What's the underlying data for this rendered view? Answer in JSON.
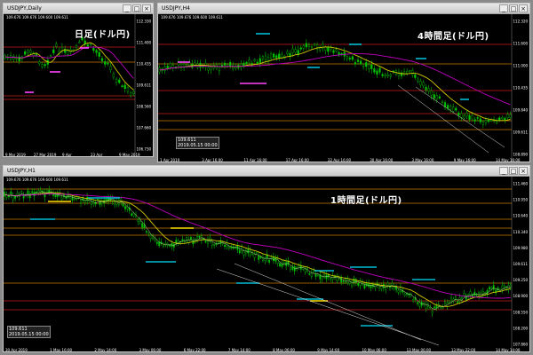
{
  "windows": [
    {
      "id": "daily",
      "title": "USDJPY,Daily",
      "ohlc": "109.676 109.676 109.600 109.611",
      "label": "日足(ドル円)",
      "times": [
        "9 Mar 2019",
        "27 Mar 2019",
        "9 Apr",
        "23 Apr",
        "9 May 2019"
      ],
      "prices": [
        "112.330",
        "111.400",
        "110.435",
        "109.611",
        "108.560",
        "107.660",
        "106.730"
      ]
    },
    {
      "id": "h4",
      "title": "USDJPY,H4",
      "ohlc": "109.676 109.676 109.600 109.611",
      "label": "4時間足(ドル円)",
      "times": [
        "1 Apr 2019",
        "3 Apr 16:00",
        "11 Apr 16:00",
        "17 Apr 16:00",
        "22 Apr 16:00",
        "30 Apr 16:00",
        "3 May 16:00",
        "9 May 16:00",
        "14 May 16:00"
      ],
      "prices": [
        "112.320",
        "111.600",
        "111.000",
        "110.435",
        "109.840",
        "109.611",
        "108.890"
      ]
    },
    {
      "id": "h1",
      "title": "USDJPY,H1",
      "ohlc": "109.676 109.676 109.600 109.611",
      "label": "1時間足(ドル円)",
      "times": [
        "30 Apr 2019",
        "1 May 16:00",
        "2 May 14:00",
        "3 May 06:00",
        "6 May 22:00",
        "7 May 14:00",
        "8 May 06:00",
        "9 May 14:00",
        "10 May 06:00",
        "13 May 06:00",
        "13 May 22:00",
        "14 May 14:00"
      ],
      "prices": [
        "111.460",
        "110.950",
        "110.640",
        "110.340",
        "109.980",
        "109.611",
        "109.250",
        "108.900",
        "108.550",
        "108.200",
        "107.860"
      ]
    }
  ],
  "tooltip": {
    "price": "109.611",
    "time": "2019.05.15 00:00"
  },
  "colors": {
    "ma_fast": "#d4c800",
    "ma_slow": "#c000c0",
    "candle": "#00c000",
    "hline_red": "#c81e1e",
    "hline_orange": "#c87800",
    "cyan": "#00bcd4",
    "magenta": "#ff44ff",
    "yellow": "#ffe000",
    "bands": "#c8c8a0"
  }
}
